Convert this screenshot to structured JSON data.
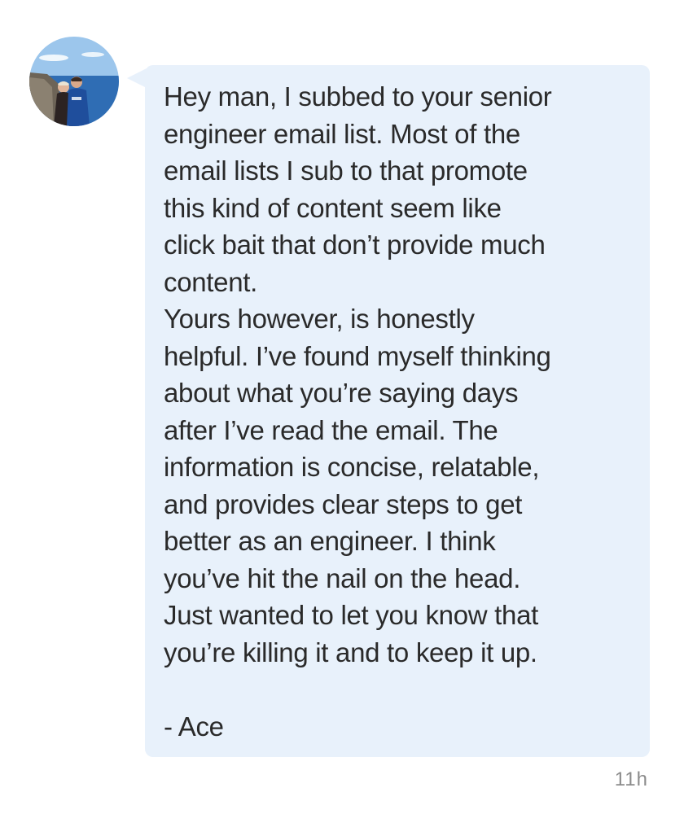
{
  "message": {
    "lines": [
      "Hey man, I subbed to your senior",
      "engineer email list. Most of the",
      "email lists I sub to that promote",
      "this kind of content seem like",
      "click bait that don’t provide much",
      "content.",
      "Yours however, is honestly",
      "helpful. I’ve found myself thinking",
      "about what you’re saying days",
      "after I’ve read the email. The",
      "information is concise, relatable,",
      "and provides clear steps to get",
      "better as an engineer. I think",
      "you’ve hit the nail on the head.",
      "Just wanted to let you know that",
      "you’re killing it and to keep it up.",
      "",
      "- Ace"
    ],
    "timestamp": "11h"
  },
  "colors": {
    "bubble_background": "#e8f1fb",
    "text": "#2a2a2a",
    "timestamp": "#8c8c8c"
  },
  "icons": {
    "avatar": "user-photo-avatar"
  }
}
